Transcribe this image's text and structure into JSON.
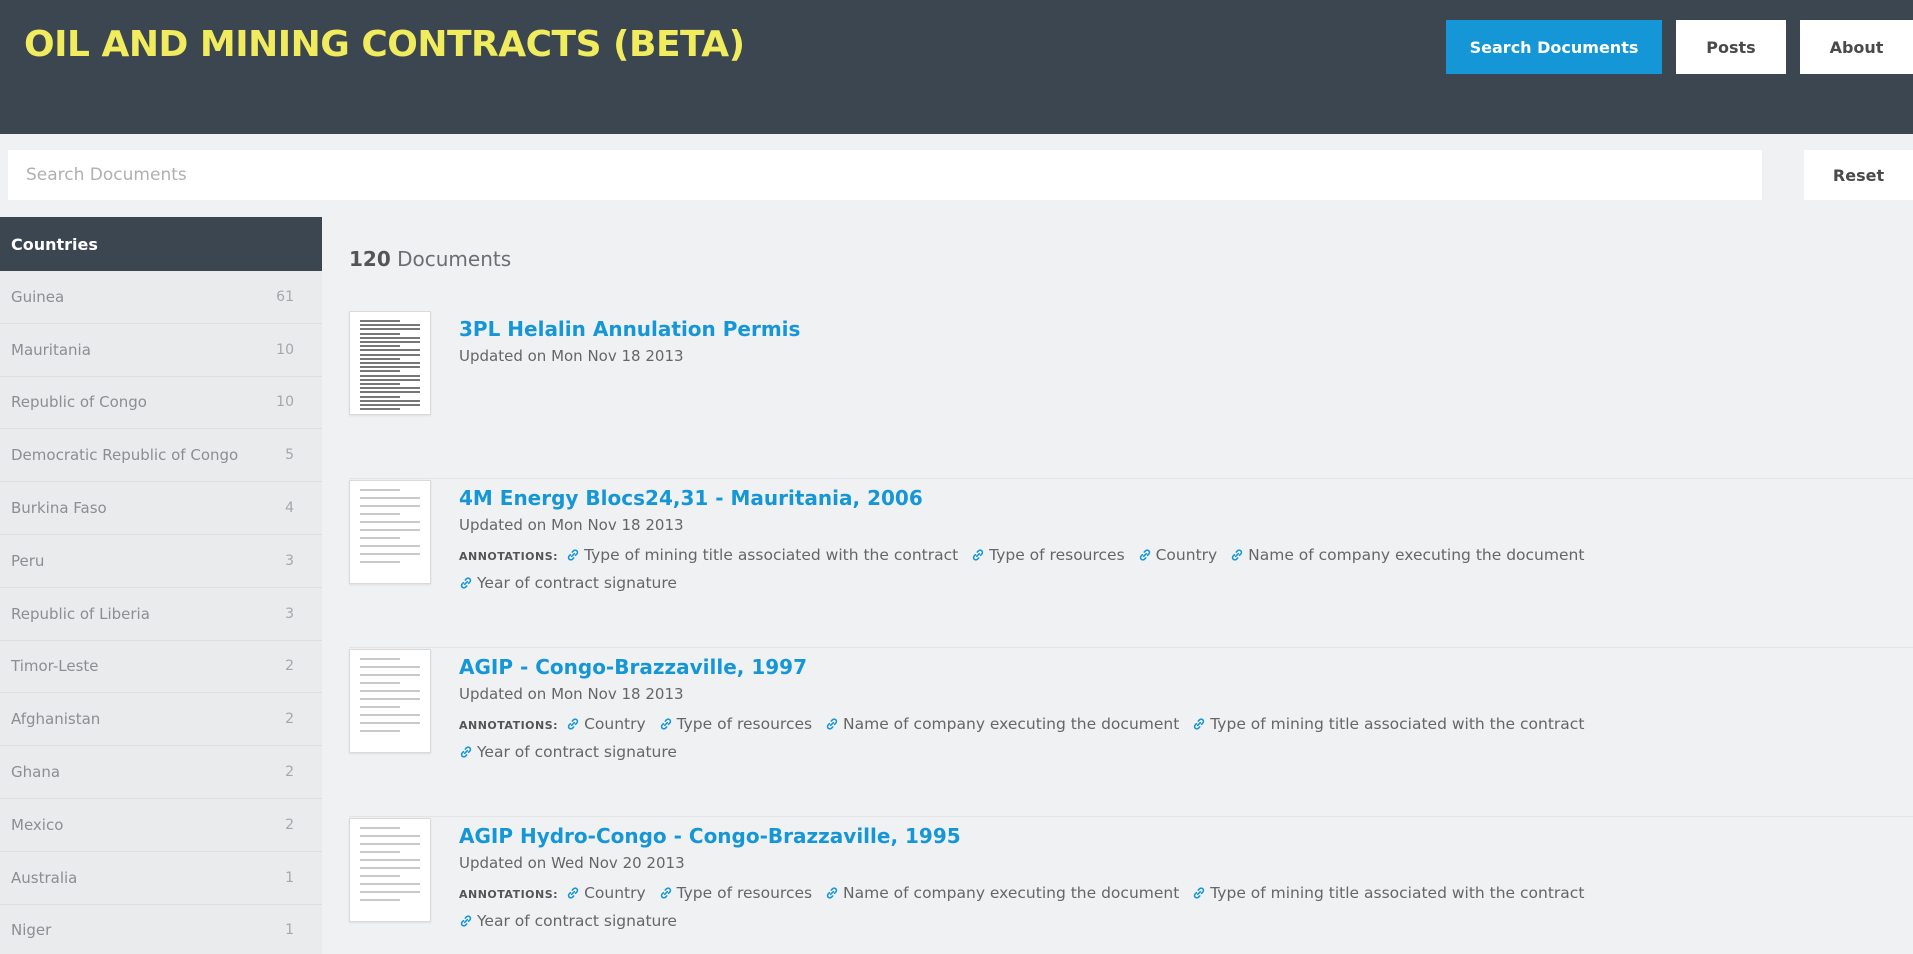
{
  "header": {
    "title": "OIL AND MINING CONTRACTS (BETA)",
    "nav": {
      "search": "Search Documents",
      "posts": "Posts",
      "about": "About"
    },
    "colors": {
      "bar": "#3b4650",
      "title": "#f0ec5e",
      "primary": "#1596d6"
    }
  },
  "search": {
    "placeholder": "Search Documents",
    "value": "",
    "reset_label": "Reset"
  },
  "sidebar": {
    "heading": "Countries",
    "items": [
      {
        "label": "Guinea",
        "count": "61"
      },
      {
        "label": "Mauritania",
        "count": "10"
      },
      {
        "label": "Republic of Congo",
        "count": "10"
      },
      {
        "label": "Democratic Republic of Congo",
        "count": "5"
      },
      {
        "label": "Burkina Faso",
        "count": "4"
      },
      {
        "label": "Peru",
        "count": "3"
      },
      {
        "label": "Republic of Liberia",
        "count": "3"
      },
      {
        "label": "Timor-Leste",
        "count": "2"
      },
      {
        "label": "Afghanistan",
        "count": "2"
      },
      {
        "label": "Ghana",
        "count": "2"
      },
      {
        "label": "Mexico",
        "count": "2"
      },
      {
        "label": "Australia",
        "count": "1"
      },
      {
        "label": "Niger",
        "count": "1"
      }
    ]
  },
  "results": {
    "count": "120",
    "count_label": "Documents",
    "annotations_label": "ANNOTATIONS:",
    "link_icon": "link-icon",
    "documents": [
      {
        "title": "3PL Helalin Annulation Permis",
        "updated": "Updated on Mon Nov 18 2013",
        "annotations": []
      },
      {
        "title": "4M Energy Blocs24,31 - Mauritania, 2006",
        "updated": "Updated on Mon Nov 18 2013",
        "annotations": [
          "Type of mining title associated with the contract",
          "Type of resources",
          "Country",
          "Name of company executing the document",
          "Year of contract signature"
        ]
      },
      {
        "title": "AGIP - Congo-Brazzaville, 1997",
        "updated": "Updated on Mon Nov 18 2013",
        "annotations": [
          "Country",
          "Type of resources",
          "Name of company executing the document",
          "Type of mining title associated with the contract",
          "Year of contract signature"
        ]
      },
      {
        "title": "AGIP Hydro-Congo - Congo-Brazzaville, 1995",
        "updated": "Updated on Wed Nov 20 2013",
        "annotations": [
          "Country",
          "Type of resources",
          "Name of company executing the document",
          "Type of mining title associated with the contract",
          "Year of contract signature"
        ]
      }
    ]
  }
}
